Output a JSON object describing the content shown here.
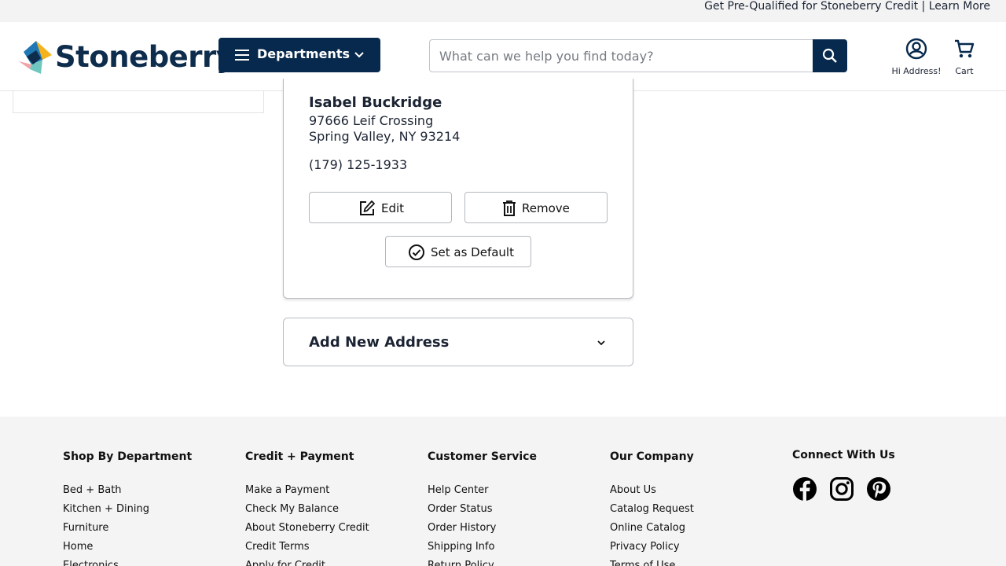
{
  "promo": {
    "text": "Get Pre-Qualified for Stoneberry Credit | Learn More"
  },
  "header": {
    "logo_text": "Stoneberry",
    "departments_label": "Departments",
    "search_placeholder": "What can we help you find today?",
    "account_label": "Hi Address!",
    "cart_label": "Cart"
  },
  "address": {
    "name": "Isabel Buckridge",
    "line1": "97666 Leif Crossing",
    "line2": "Spring Valley, NY 93214",
    "phone": "(179) 125-1933",
    "edit_label": "Edit",
    "remove_label": "Remove",
    "default_label": "Set as Default"
  },
  "add_address": {
    "label": "Add New Address"
  },
  "footer": {
    "columns": [
      {
        "title": "Shop By Department",
        "links": [
          "Bed + Bath",
          "Kitchen + Dining",
          "Furniture",
          "Home",
          "Electronics"
        ]
      },
      {
        "title": "Credit + Payment",
        "links": [
          "Make a Payment",
          "Check My Balance",
          "About Stoneberry Credit",
          "Credit Terms",
          "Apply for Credit"
        ]
      },
      {
        "title": "Customer Service",
        "links": [
          "Help Center",
          "Order Status",
          "Order History",
          "Shipping Info",
          "Return Policy"
        ]
      },
      {
        "title": "Our Company",
        "links": [
          "About Us",
          "Catalog Request",
          "Online Catalog",
          "Privacy Policy",
          "Terms of Use"
        ]
      }
    ],
    "social_title": "Connect With Us",
    "social_icons": [
      "facebook-icon",
      "instagram-icon",
      "pinterest-icon"
    ]
  },
  "colors": {
    "brand_navy": "#07294d",
    "footer_bg": "#f4f4f4",
    "promo_bg": "#f3f3f3"
  }
}
